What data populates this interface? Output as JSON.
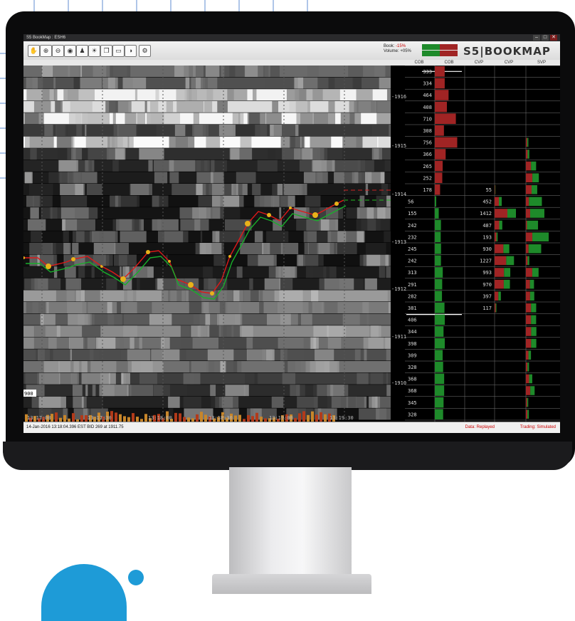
{
  "window": {
    "title": "S5 BookMap : ESH6",
    "controls": [
      "–",
      "□",
      "✕"
    ]
  },
  "toolbar": {
    "icons": [
      "hand-icon",
      "zoom-in-icon",
      "zoom-out-icon",
      "camera-icon",
      "person-icon",
      "brightness-icon",
      "window-icon",
      "monitor-icon",
      "contrast-icon",
      "gear-icon"
    ],
    "glyphs": [
      "✋",
      "⊕",
      "⊖",
      "◉",
      "♟",
      "☀",
      "❐",
      "▭",
      "◑",
      "⚙"
    ],
    "book_label": "Book:",
    "book_value": "-15%",
    "volume_label": "Volume:",
    "volume_value": "+05%",
    "logo": "S5|BOOKMAP"
  },
  "columns": [
    "COB",
    "COB",
    "CVP",
    "CVP",
    "SVP"
  ],
  "price_labels": [
    "1916",
    "1915",
    "1914",
    "1913",
    "1912",
    "1911",
    "1910"
  ],
  "time_labels": [
    "13:17:00",
    "13:17:30",
    "13:18:00",
    "13:18:30",
    "13:19:00",
    "13:19:30"
  ],
  "volume_scale_label": "900",
  "ask_side": {
    "values": [
      "333",
      "334",
      "464",
      "408",
      "710",
      "308",
      "756",
      "366",
      "265",
      "252",
      "178"
    ]
  },
  "bid_side": {
    "values": [
      "56",
      "155",
      "242",
      "232",
      "245",
      "242",
      "313",
      "291",
      "282",
      "381",
      "406",
      "344",
      "398",
      "309",
      "328",
      "368",
      "368",
      "345",
      "328"
    ]
  },
  "cvp": {
    "values": [
      "55",
      "452",
      "1412",
      "487",
      "193",
      "930",
      "1227",
      "993",
      "970",
      "397",
      "117"
    ]
  },
  "status": {
    "left": "14-Jan-2016 13:18:04.396 EST   BID 269 at 1911.75",
    "data_mode": "Data: Replayed",
    "trading_mode": "Trading: Simulated"
  },
  "colors": {
    "bid": "#1e8a2a",
    "ask": "#a02424",
    "trade_line_up": "#e01818",
    "trade_line_down": "#17b02a",
    "trade_dot": "#e8b21a",
    "accent_blue": "#1e9bd7"
  }
}
